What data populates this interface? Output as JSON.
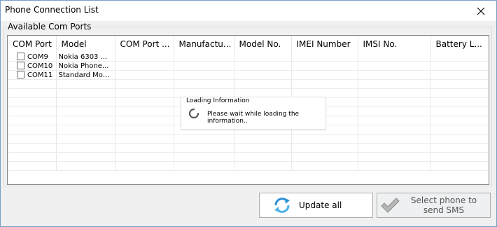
{
  "window": {
    "title": "Phone Connection List"
  },
  "group": {
    "title": "Available Com Ports"
  },
  "columns": [
    "COM Port",
    "Model",
    "COM Port ...",
    "Manufactu...",
    "Model No.",
    "IMEI Number",
    "IMSI No.",
    "Battery L..."
  ],
  "rows": [
    {
      "port": "COM9",
      "model": "Nokia 6303 ..."
    },
    {
      "port": "COM10",
      "model": "Nokia Phone..."
    },
    {
      "port": "COM11",
      "model": "Standard Mo..."
    }
  ],
  "loading": {
    "title": "Loading Information",
    "message": "Please wait while loading the information.."
  },
  "buttons": {
    "update_all": "Update all",
    "send_sms": "Select phone to send SMS"
  },
  "colors": {
    "list_border": "#828790",
    "window_border": "#7a9fc7",
    "refresh_blue": "#2f8fd8",
    "check_gray": "#9a9a9a"
  }
}
